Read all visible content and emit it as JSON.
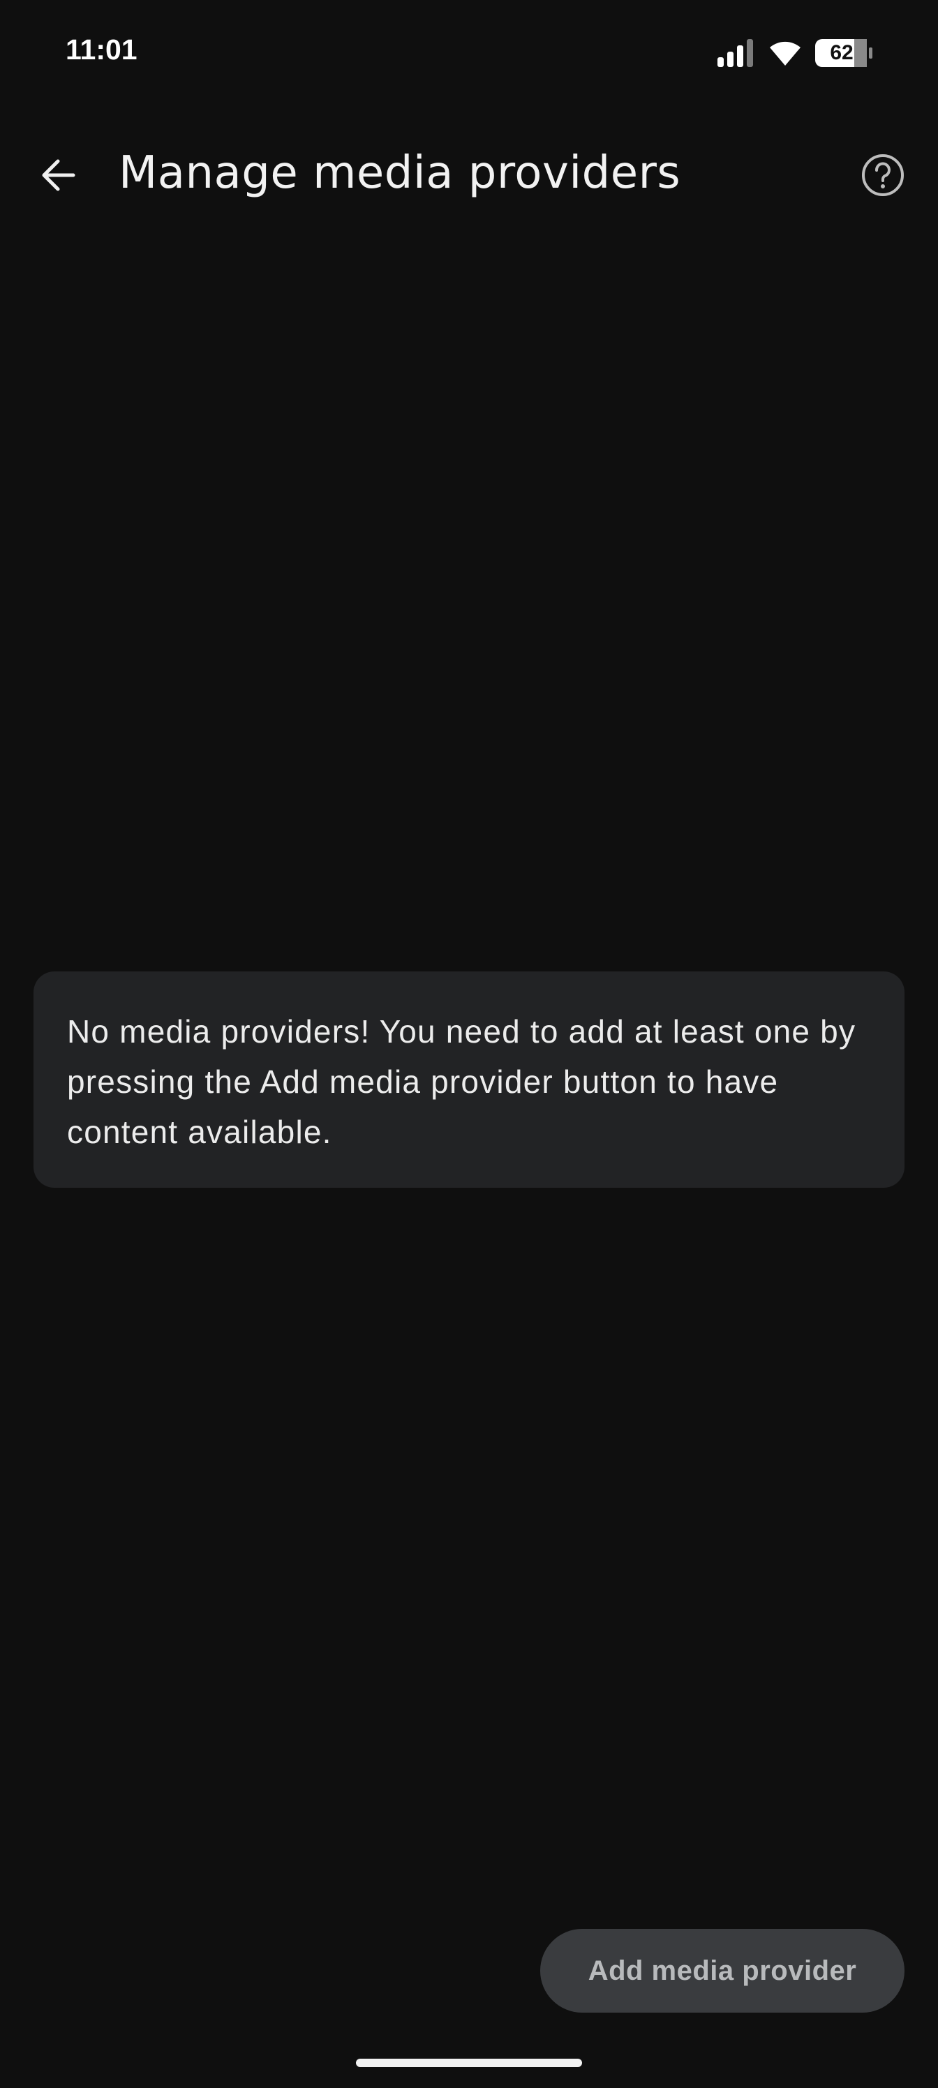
{
  "status_bar": {
    "time": "11:01",
    "battery_level": "62",
    "icons": [
      "signal-icon",
      "wifi-icon",
      "battery-icon"
    ]
  },
  "app_bar": {
    "title": "Manage media providers",
    "back_icon": "arrow-left-icon",
    "help_icon": "help-circle-icon"
  },
  "empty_state": {
    "message": "No media providers! You need to add at least one by pressing the Add media provider button to have content available."
  },
  "fab": {
    "label": "Add media provider"
  },
  "colors": {
    "background": "#0f0f0f",
    "card": "#222325",
    "fab_background": "#3a3c3f",
    "fab_text": "#b8babc"
  }
}
